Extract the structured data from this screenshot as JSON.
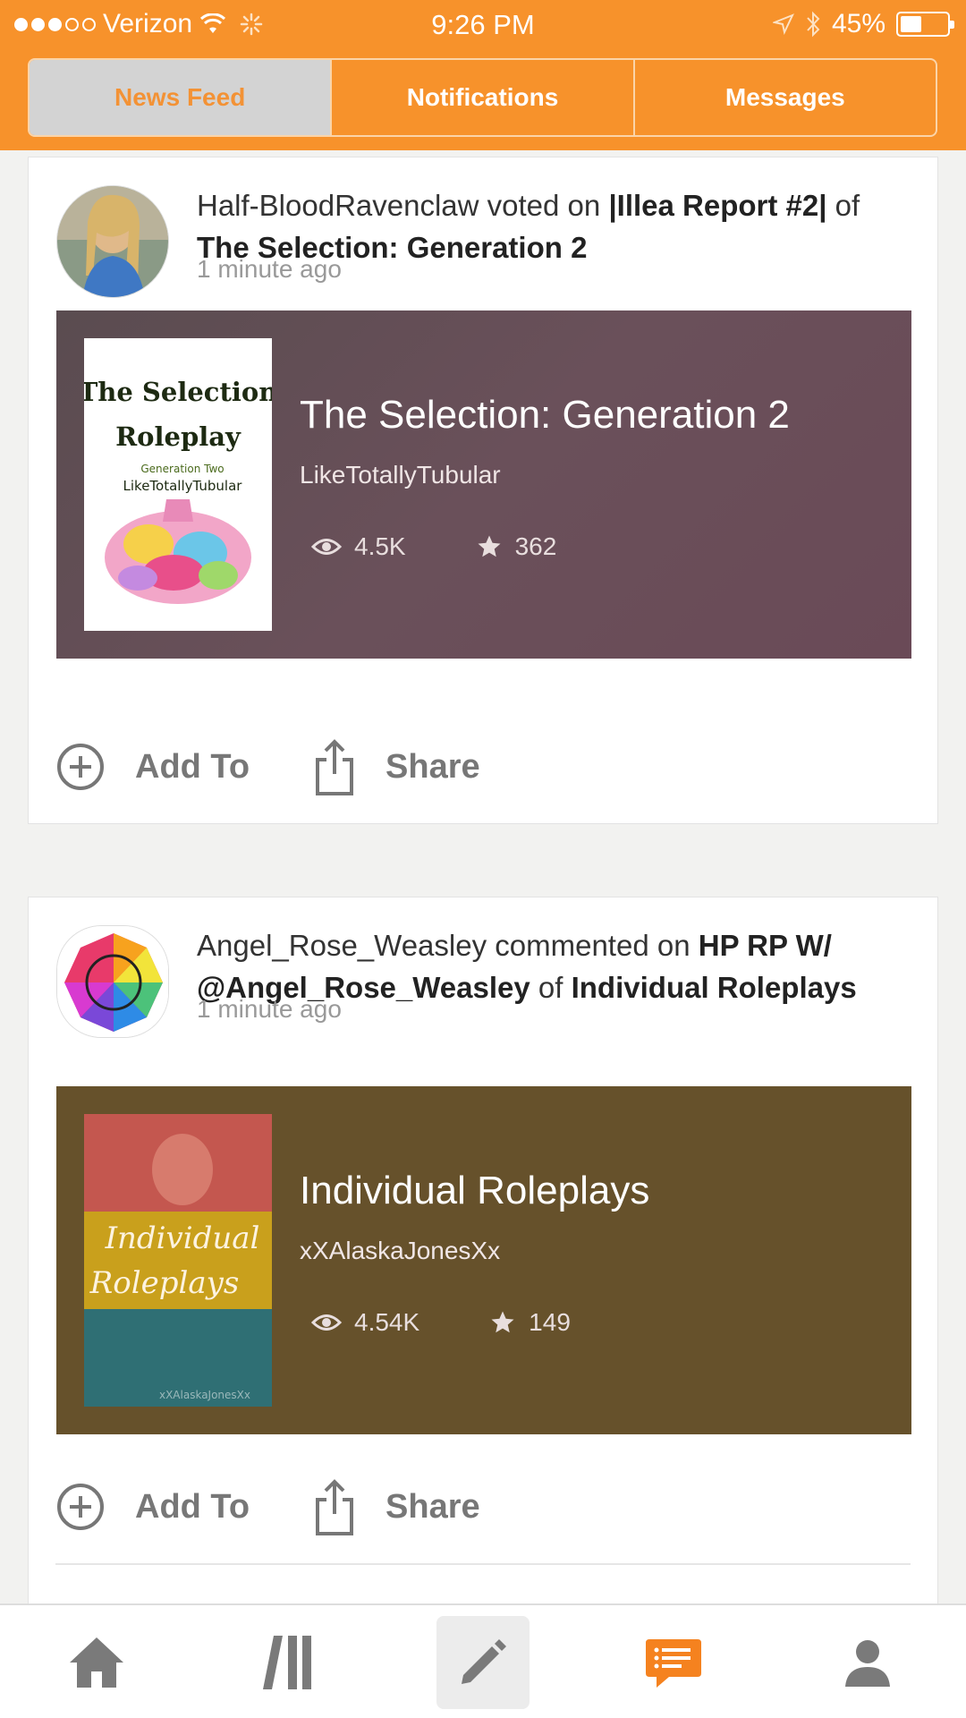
{
  "status_bar": {
    "carrier": "Verizon",
    "time": "9:26 PM",
    "battery": "45%",
    "battery_level": 0.45
  },
  "tabs": [
    {
      "label": "News Feed",
      "active": true
    },
    {
      "label": "Notifications",
      "active": false
    },
    {
      "label": "Messages",
      "active": false
    }
  ],
  "feed": [
    {
      "user": "Half-BloodRavenclaw",
      "action": "voted on",
      "item": "|Illea Report #2|",
      "connector": "of",
      "story_ref": "The Selection: Generation 2",
      "time": "1 minute ago",
      "story": {
        "title": "The Selection: Generation 2",
        "author": "LikeTotallyTubular",
        "reads": "4.5K",
        "votes": "362",
        "cover": {
          "line1": "The Selection",
          "line2": "Roleplay",
          "line3": "Generation Two",
          "line4": "LikeTotallyTubular"
        }
      },
      "add_label": "Add To",
      "share_label": "Share"
    },
    {
      "user": "Angel_Rose_Weasley",
      "action": "commented on",
      "item": "HP RP W/ @Angel_Rose_Weasley",
      "connector": "of",
      "story_ref": "Individual Roleplays",
      "time": "1 minute ago",
      "story": {
        "title": "Individual Roleplays",
        "author": "xXAlaskaJonesXx",
        "reads": "4.54K",
        "votes": "149",
        "cover": {
          "line1": "Individual",
          "line2": "Roleplays",
          "line3": "xXAlaskaJonesXx"
        }
      },
      "add_label": "Add To",
      "share_label": "Share"
    }
  ],
  "colors": {
    "brand_orange": "#f7922b",
    "chat_icon": "#f5821f",
    "story1_bg": "#5e4d54",
    "story2_bg": "#66512b"
  },
  "tab_bar": [
    {
      "name": "home-icon"
    },
    {
      "name": "library-icon"
    },
    {
      "name": "write-icon"
    },
    {
      "name": "chat-icon",
      "active": true
    },
    {
      "name": "profile-icon"
    }
  ]
}
